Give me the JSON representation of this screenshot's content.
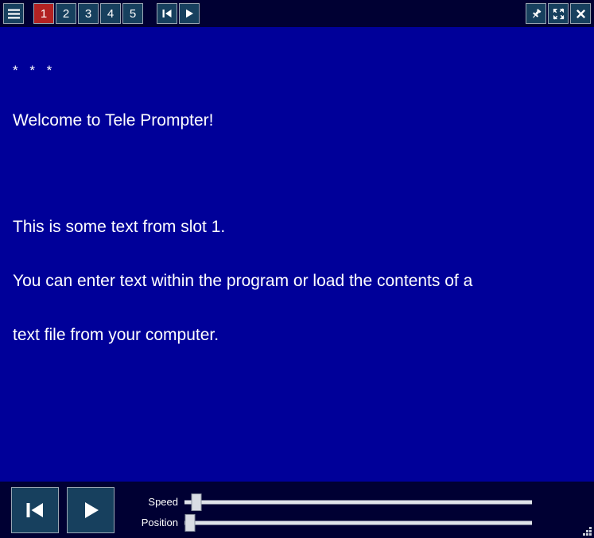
{
  "app": {
    "title": "Tele Prompter",
    "colors": {
      "toolbar_bg": "#000033",
      "prompter_bg": "#000099",
      "button_bg": "#17405e",
      "button_border": "#9aa7b4",
      "active_slot_bg": "#b22222",
      "text": "#ffffff",
      "slider_track": "#dfe3ea",
      "slider_thumb": "#d9dde4"
    }
  },
  "toolbar": {
    "menu_button": {
      "label": "",
      "icon": "hamburger-menu-icon",
      "tooltip": "Menu"
    },
    "slots": [
      {
        "label": "1",
        "active": true
      },
      {
        "label": "2",
        "active": false
      },
      {
        "label": "3",
        "active": false
      },
      {
        "label": "4",
        "active": false
      },
      {
        "label": "5",
        "active": false
      }
    ],
    "transport": [
      {
        "name": "rewind-to-start-button",
        "icon": "skip-to-start-icon",
        "label": ""
      },
      {
        "name": "play-button",
        "icon": "play-icon",
        "label": ""
      }
    ],
    "window_buttons": [
      {
        "name": "pin-on-top-button",
        "icon": "pin-icon",
        "label": ""
      },
      {
        "name": "fullscreen-button",
        "icon": "fullscreen-expand-icon",
        "label": ""
      },
      {
        "name": "close-button",
        "icon": "close-x-icon",
        "label": ""
      }
    ]
  },
  "prompter": {
    "lines": [
      {
        "text": "* * *",
        "style": "stars"
      },
      {
        "text": "Welcome to Tele Prompter!",
        "style": "normal"
      },
      {
        "text": "",
        "style": "blank"
      },
      {
        "text": "This is some text from slot 1.",
        "style": "normal"
      },
      {
        "text": "You can enter text within the program or load the contents of a",
        "style": "normal"
      },
      {
        "text": "text file from your computer.",
        "style": "normal"
      }
    ]
  },
  "controls": {
    "buttons": [
      {
        "name": "restart-button",
        "icon": "skip-to-start-icon",
        "label": ""
      },
      {
        "name": "play-button",
        "icon": "play-icon",
        "label": ""
      }
    ],
    "sliders": [
      {
        "name": "speed-slider",
        "label": "Speed",
        "value": 2,
        "min": 0,
        "max": 100
      },
      {
        "name": "position-slider",
        "label": "Position",
        "value": 0,
        "min": 0,
        "max": 100
      }
    ]
  },
  "statusbar": {
    "resize_grip": "resize-grip-icon"
  }
}
